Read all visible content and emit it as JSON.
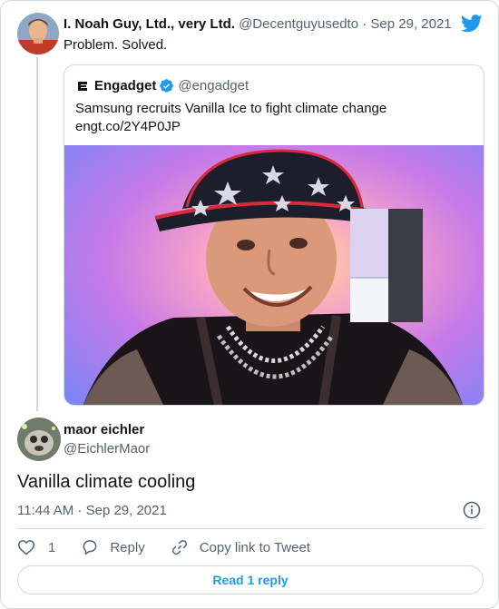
{
  "parent": {
    "name": "I. Noah Guy, Ltd., very Ltd.",
    "handle": "@Decentguyusedto",
    "separator": "·",
    "date": "Sep 29, 2021",
    "text": "Problem. Solved."
  },
  "quote": {
    "name": "Engadget",
    "handle": "@engadget",
    "headline": "Samsung recruits Vanilla Ice to fight climate change",
    "link": "engt.co/2Y4P0JP"
  },
  "reply": {
    "name": "maor eichler",
    "handle": "@EichlerMaor",
    "text": "Vanilla climate cooling",
    "time": "11:44 AM · Sep 29, 2021"
  },
  "actions": {
    "like_count": "1",
    "reply_label": "Reply",
    "copy_label": "Copy link to Tweet"
  },
  "footer": {
    "read_reply_label": "Read 1 reply"
  },
  "colors": {
    "accent": "#1d9bf0",
    "secondary_text": "#536471",
    "border": "#cfd9de"
  }
}
